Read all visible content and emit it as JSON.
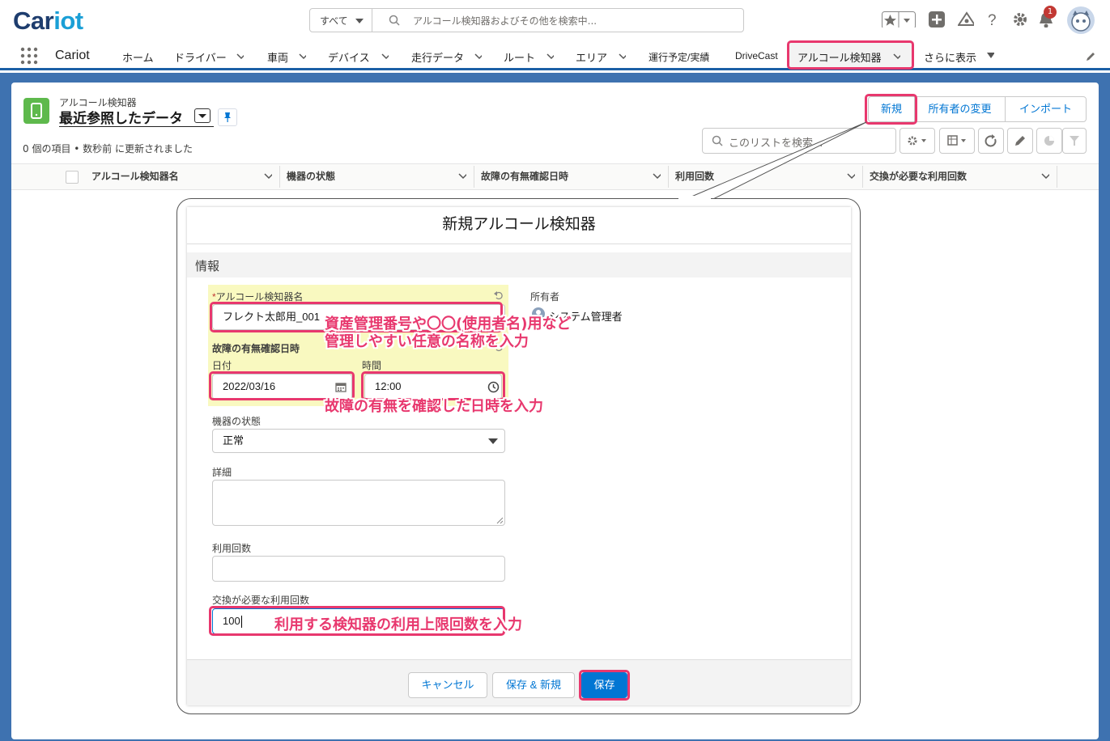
{
  "header": {
    "logo": {
      "part1": "Car",
      "part2": "iot"
    },
    "search_scope": "すべて",
    "search_placeholder": "アルコール検知器およびその他を検索中...",
    "notification_count": "1"
  },
  "nav": {
    "app_name": "Cariot",
    "items": [
      {
        "label": "ホーム"
      },
      {
        "label": "ドライバー"
      },
      {
        "label": "車両"
      },
      {
        "label": "デバイス"
      },
      {
        "label": "走行データ"
      },
      {
        "label": "ルート"
      },
      {
        "label": "エリア"
      },
      {
        "label": "運行予定/実績"
      },
      {
        "label": "DriveCast"
      },
      {
        "label": "アルコール検知器"
      },
      {
        "label": "さらに表示"
      }
    ]
  },
  "list": {
    "object_label": "アルコール検知器",
    "view_name": "最近参照したデータ",
    "meta": "0 個の項目 • 数秒前 に更新されました",
    "buttons": {
      "new": "新規",
      "change_owner": "所有者の変更",
      "import": "インポート"
    },
    "search_placeholder": "このリストを検索...",
    "columns": [
      "アルコール検知器名",
      "機器の状態",
      "故障の有無確認日時",
      "利用回数",
      "交換が必要な利用回数"
    ]
  },
  "modal": {
    "title": "新規アルコール検知器",
    "section": "情報",
    "fields": {
      "name_required": "*",
      "name_label": "アルコール検知器名",
      "name_value": "フレクト太郎用_001",
      "owner_label": "所有者",
      "owner_value": "システム管理者",
      "check_label": "故障の有無確認日時",
      "date_label": "日付",
      "date_value": "2022/03/16",
      "time_label": "時間",
      "time_value": "12:00",
      "status_label": "機器の状態",
      "status_value": "正常",
      "detail_label": "詳細",
      "usage_label": "利用回数",
      "usage_value": "",
      "limit_label": "交換が必要な利用回数",
      "limit_value": "100"
    },
    "buttons": {
      "cancel": "キャンセル",
      "save_new": "保存 & 新規",
      "save": "保存"
    }
  },
  "annotations": {
    "name_line1": "資産管理番号や〇〇(使用者名)用など",
    "name_line2": "管理しやすい任意の名称を入力",
    "datetime": "故障の有無を確認した日時を入力",
    "limit": "利用する検知器の利用上限回数を入力"
  },
  "colors": {
    "brand": "#1e3d6e",
    "accent": "#e8386e",
    "link": "#0176d3",
    "primary_button": "#0176d3"
  }
}
